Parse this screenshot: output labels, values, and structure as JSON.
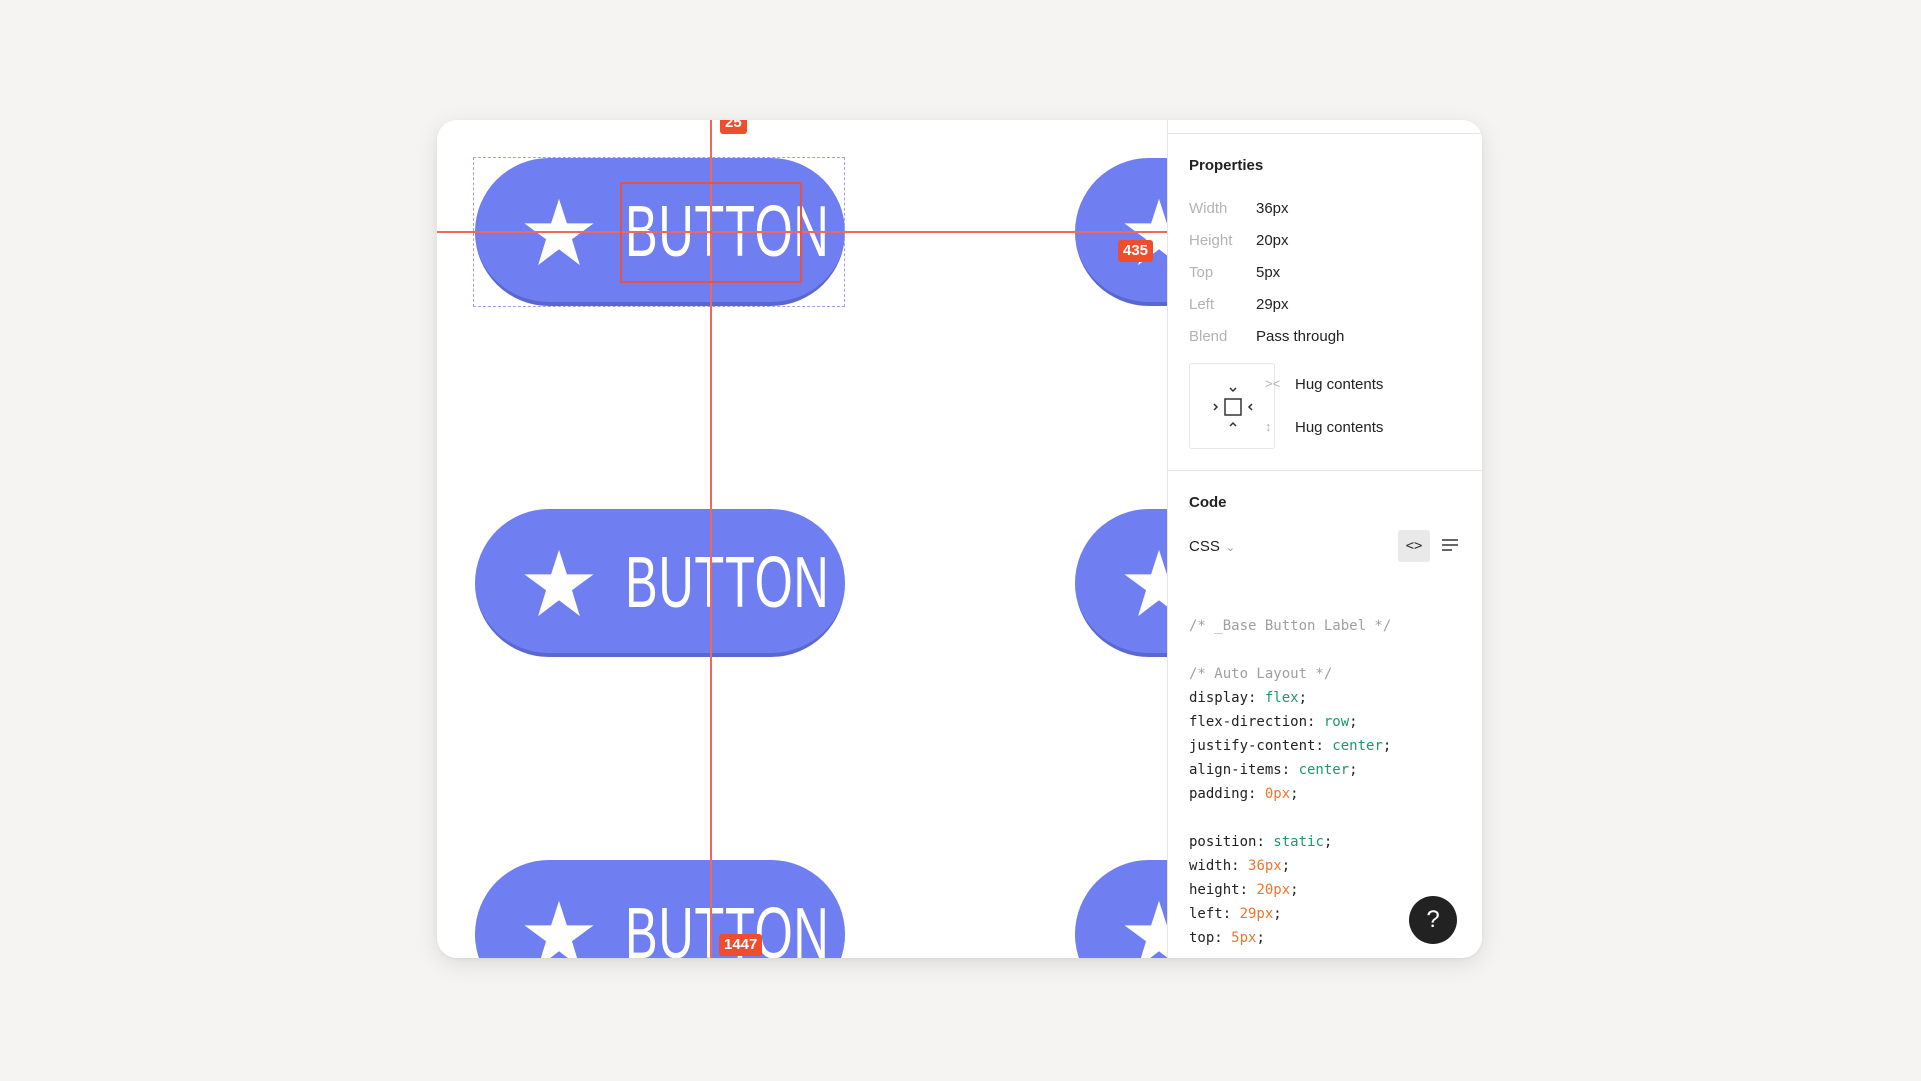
{
  "canvas": {
    "button_label": "BUTTON",
    "measure_top": "25",
    "measure_right": "435",
    "measure_bottom": "1447",
    "accent_color": "#6f7ef0",
    "guide_color": "#f0685d"
  },
  "properties": {
    "title": "Properties",
    "rows": [
      {
        "key": "Width",
        "value": "36px"
      },
      {
        "key": "Height",
        "value": "20px"
      },
      {
        "key": "Top",
        "value": "5px"
      },
      {
        "key": "Left",
        "value": "29px"
      },
      {
        "key": "Blend",
        "value": "Pass through"
      }
    ],
    "hug_horizontal": "Hug contents",
    "hug_vertical": "Hug contents"
  },
  "code": {
    "title": "Code",
    "language": "CSS",
    "lines": {
      "l1": "/* _Base Button Label */",
      "l2": "/* Auto Layout */",
      "l3k": "display",
      "l3v": "flex",
      "l4k": "flex-direction",
      "l4v": "row",
      "l5k": "justify-content",
      "l5v": "center",
      "l6k": "align-items",
      "l6v": "center",
      "l7k": "padding",
      "l7v": "0px",
      "l8k": "position",
      "l8v": "static",
      "l9k": "width",
      "l9v": "36px",
      "l10k": "height",
      "l10v": "20px",
      "l11k": "left",
      "l11v": "29px",
      "l12k": "top",
      "l12v": "5px"
    }
  },
  "help": {
    "label": "?"
  }
}
